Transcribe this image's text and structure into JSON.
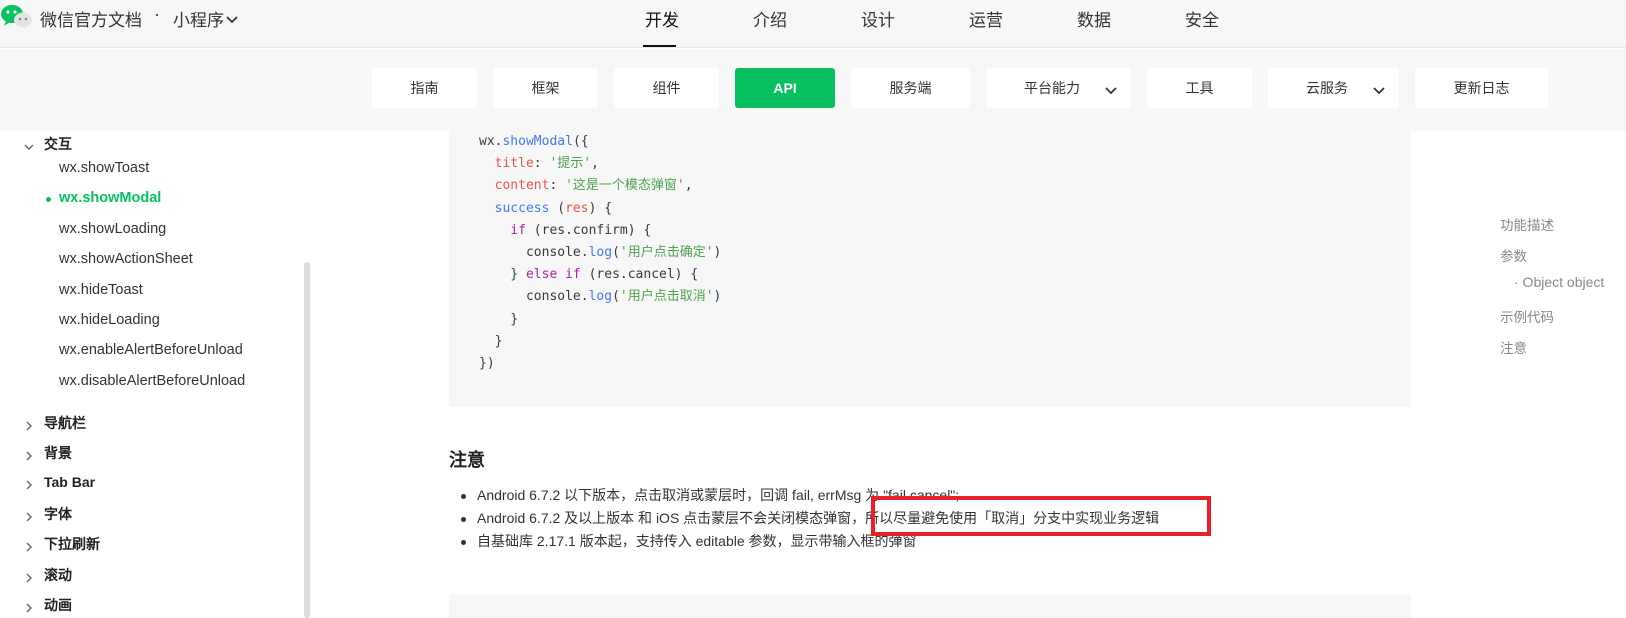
{
  "header": {
    "brand": "微信官方文档",
    "separator": "·",
    "product": "小程序",
    "nav": [
      "开发",
      "介绍",
      "设计",
      "运营",
      "数据",
      "安全"
    ],
    "active_nav": "开发"
  },
  "subnav": {
    "items": [
      {
        "label": "指南"
      },
      {
        "label": "框架"
      },
      {
        "label": "组件"
      },
      {
        "label": "API",
        "active": true
      },
      {
        "label": "服务端"
      },
      {
        "label": "平台能力",
        "dropdown": true
      },
      {
        "label": "工具"
      },
      {
        "label": "云服务",
        "dropdown": true
      },
      {
        "label": "更新日志"
      }
    ]
  },
  "sidebar": {
    "open_group": "交互",
    "items": [
      "wx.showToast",
      "wx.showModal",
      "wx.showLoading",
      "wx.showActionSheet",
      "wx.hideToast",
      "wx.hideLoading",
      "wx.enableAlertBeforeUnload",
      "wx.disableAlertBeforeUnload"
    ],
    "active_item": "wx.showModal",
    "groups": [
      "导航栏",
      "背景",
      "Tab Bar",
      "字体",
      "下拉刷新",
      "滚动",
      "动画"
    ]
  },
  "code": {
    "lines": [
      "wx.showModal({",
      "  title: '提示',",
      "  content: '这是一个模态弹窗',",
      "  success (res) {",
      "    if (res.confirm) {",
      "      console.log('用户点击确定')",
      "    } else if (res.cancel) {",
      "      console.log('用户点击取消')",
      "    }",
      "  }",
      "})"
    ]
  },
  "notes": {
    "heading": "注意",
    "items": [
      "Android 6.7.2 以下版本，点击取消或蒙层时，回调 fail, errMsg 为 \"fail cancel\";",
      "Android 6.7.2 及以上版本 和 iOS 点击蒙层不会关闭模态弹窗，所以尽量避免使用「取消」分支中实现业务逻辑",
      "自基础库 2.17.1 版本起，支持传入 editable 参数，显示带输入框的弹窗"
    ]
  },
  "toc": {
    "items": [
      "功能描述",
      "参数",
      "· Object object",
      "示例代码",
      "注意"
    ]
  },
  "colors": {
    "brand_green": "#07c160",
    "highlight_red": "#e8202a"
  }
}
